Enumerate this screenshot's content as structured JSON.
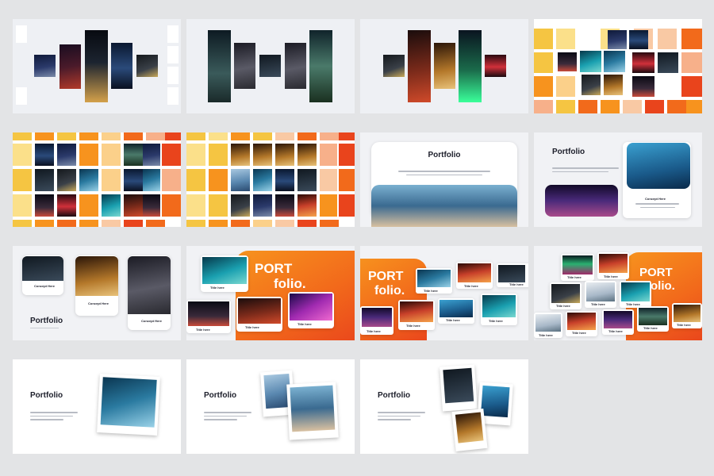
{
  "slides": {
    "portfolio_title": "Portfolio",
    "port_word": "PORT",
    "folio_word": "folio.",
    "concept_label": "Concept Here",
    "title_label": "Title here"
  },
  "colors": {
    "background": "#e3e4e6",
    "orange_1": "#f7931e",
    "orange_2": "#e9441c",
    "yellow": "#f5c542",
    "peach": "#f7b08a"
  },
  "icons": {
    "photo": "photo-placeholder",
    "polaroid": "polaroid-frame"
  }
}
